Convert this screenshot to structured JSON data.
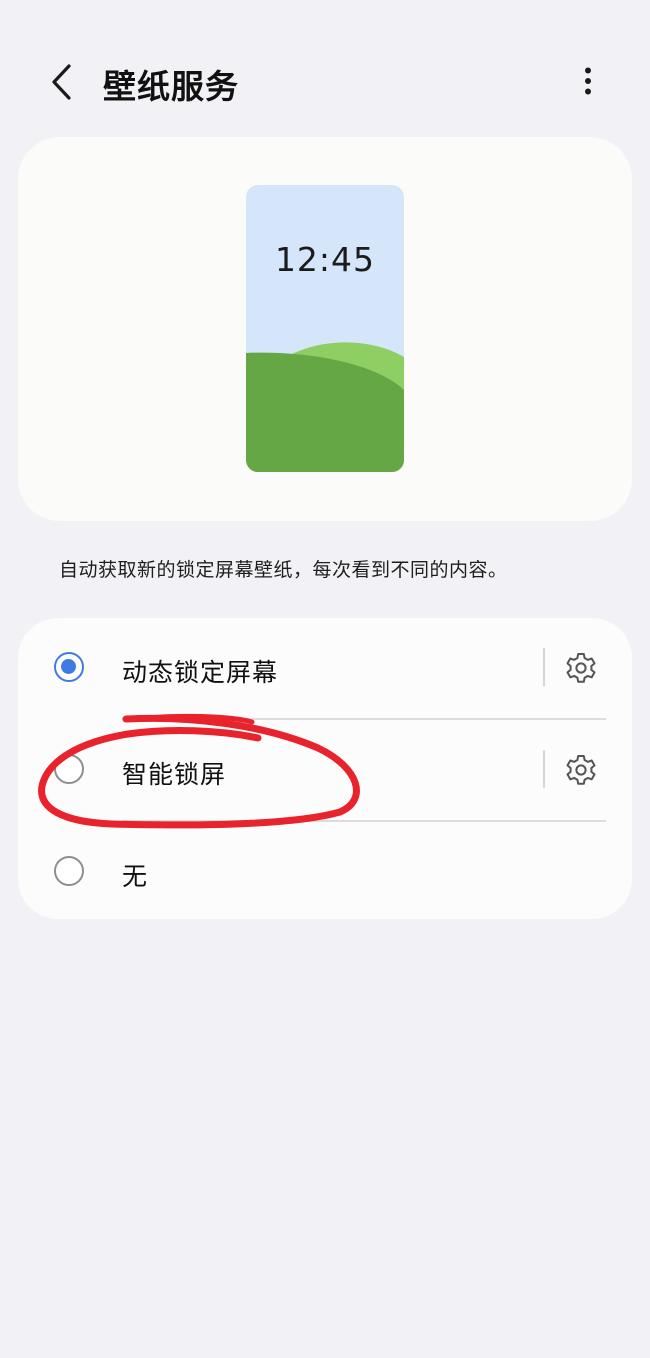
{
  "header": {
    "title": "壁纸服务",
    "back_icon": "chevron-left-icon",
    "more_icon": "more-vertical-icon"
  },
  "preview": {
    "clock_time": "12:45",
    "colors": {
      "sky": "#d6e6fa",
      "hill_back": "#8fce63",
      "hill_front": "#65a744"
    }
  },
  "description": "自动获取新的锁定屏幕壁纸，每次看到不同的内容。",
  "options": [
    {
      "label": "动态锁定屏幕",
      "selected": true,
      "has_settings": true,
      "settings_icon": "gear-icon"
    },
    {
      "label": "智能锁屏",
      "selected": false,
      "has_settings": true,
      "settings_icon": "gear-icon"
    },
    {
      "label": "无",
      "selected": false,
      "has_settings": false
    }
  ],
  "colors": {
    "background": "#f2f1f6",
    "accent": "#3f7be0",
    "annotation": "#e8232b"
  }
}
